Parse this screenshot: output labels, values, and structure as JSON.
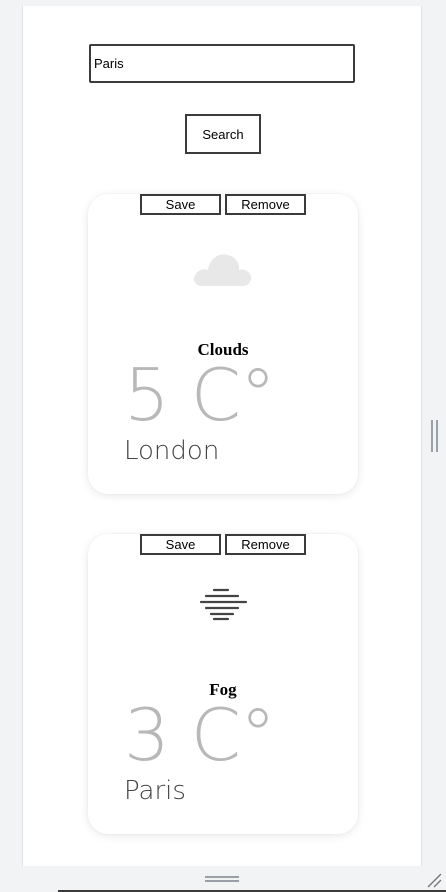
{
  "search": {
    "value": "Paris",
    "button_label": "Search"
  },
  "cards": [
    {
      "save_label": "Save",
      "remove_label": "Remove",
      "icon": "cloud-icon",
      "condition": "Clouds",
      "temperature": "5 C°",
      "city": "London"
    },
    {
      "save_label": "Save",
      "remove_label": "Remove",
      "icon": "fog-icon",
      "condition": "Fog",
      "temperature": "3 C°",
      "city": "Paris"
    }
  ],
  "colors": {
    "page_background": "#ffffff",
    "outer_background": "#f1f3f4",
    "border": "#3b3b3b",
    "temperature_text": "#b8b8b8",
    "city_text": "#444444",
    "cloud_icon": "#e8e8e8",
    "fog_icon": "#444444"
  }
}
